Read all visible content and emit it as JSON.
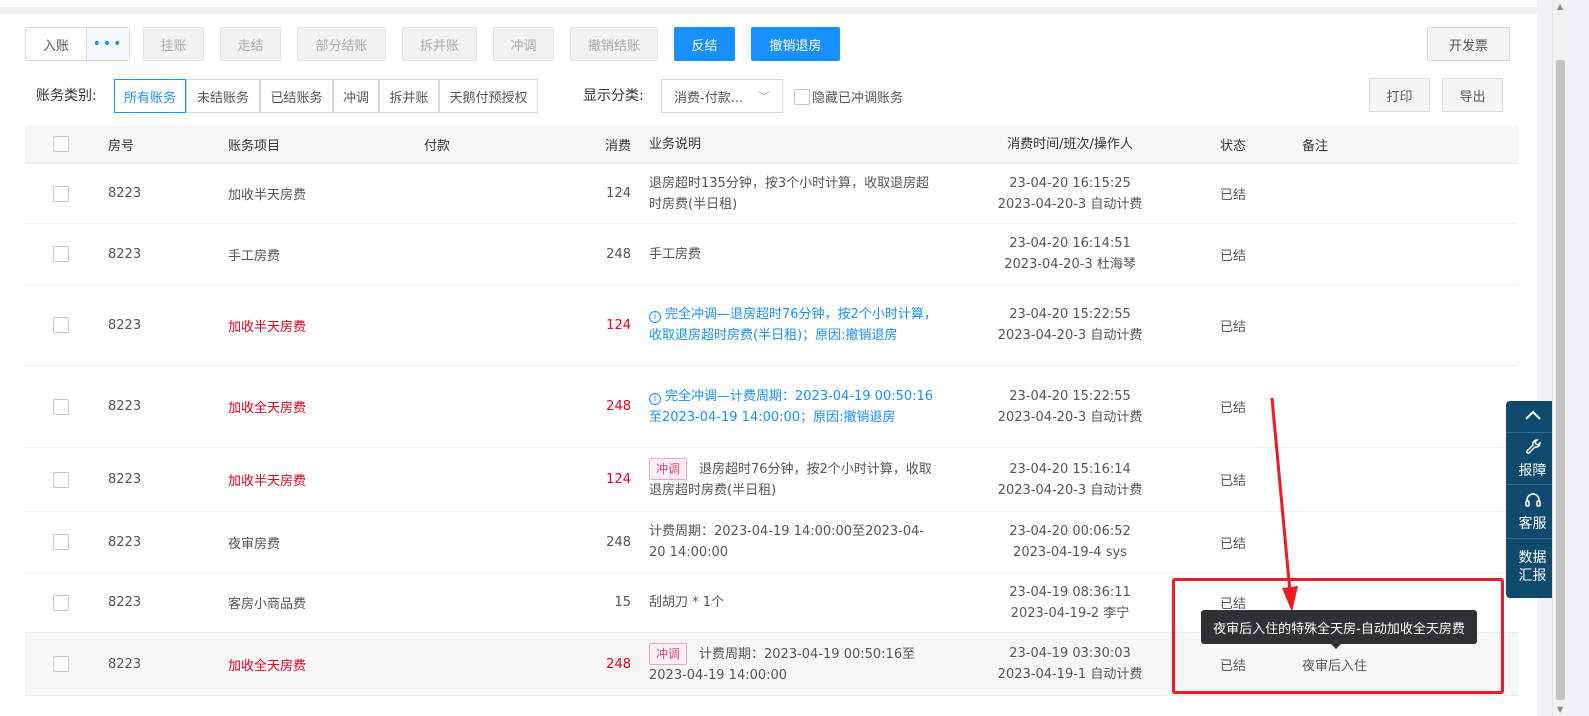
{
  "toolbar": {
    "post_label": "入账",
    "more_label": "•••",
    "disabled_buttons": [
      "挂账",
      "走结",
      "部分结账",
      "拆并账",
      "冲调",
      "撤销结账"
    ],
    "reverse_checkout_label": "反结",
    "cancel_checkout_label": "撤销退房",
    "invoice_label": "开发票",
    "print_label": "打印",
    "export_label": "导出"
  },
  "filters": {
    "category_label": "账务类别:",
    "categories": [
      "所有账务",
      "未结账务",
      "已结账务",
      "冲调",
      "拆并账",
      "天鹅付预授权"
    ],
    "active_category": "所有账务",
    "display_label": "显示分类:",
    "display_value": "消费-付款...",
    "hide_reversed_label": "隐藏已冲调账务"
  },
  "table": {
    "headers": {
      "room": "房号",
      "item": "账务项目",
      "payment": "付款",
      "amount": "消费",
      "description": "业务说明",
      "time": "消费时间/班次/操作人",
      "status": "状态",
      "note": "备注"
    },
    "rows": [
      {
        "room": "8223",
        "item": "加收半天房费",
        "amount": "124",
        "red": false,
        "tag": "",
        "info": false,
        "description": "退房超时135分钟，按3个小时计算，收取退房超时房费(半日租)",
        "time1": "23-04-20 16:15:25",
        "time2": "2023-04-20-3 自动计费",
        "status": "已结",
        "note": ""
      },
      {
        "room": "8223",
        "item": "手工房费",
        "amount": "248",
        "red": false,
        "tag": "",
        "info": false,
        "description": "手工房费",
        "time1": "23-04-20 16:14:51",
        "time2": "2023-04-20-3 杜海琴",
        "status": "已结",
        "note": ""
      },
      {
        "room": "8223",
        "item": "加收半天房费",
        "amount": "124",
        "red": true,
        "tag": "",
        "info": true,
        "description": "完全冲调—退房超时76分钟，按2个小时计算，收取退房超时房费(半日租)；原因:撤销退房",
        "time1": "23-04-20 15:22:55",
        "time2": "2023-04-20-3 自动计费",
        "status": "已结",
        "note": ""
      },
      {
        "room": "8223",
        "item": "加收全天房费",
        "amount": "248",
        "red": true,
        "tag": "",
        "info": true,
        "description": "完全冲调—计费周期：2023-04-19 00:50:16至2023-04-19 14:00:00；原因:撤销退房",
        "time1": "23-04-20 15:22:55",
        "time2": "2023-04-20-3 自动计费",
        "status": "已结",
        "note": ""
      },
      {
        "room": "8223",
        "item": "加收半天房费",
        "amount": "124",
        "red": true,
        "tag": "冲调",
        "info": false,
        "description": "退房超时76分钟，按2个小时计算，收取退房超时房费(半日租)",
        "time1": "23-04-20 15:16:14",
        "time2": "2023-04-20-3 自动计费",
        "status": "已结",
        "note": ""
      },
      {
        "room": "8223",
        "item": "夜审房费",
        "amount": "248",
        "red": false,
        "tag": "",
        "info": false,
        "description": "计费周期：2023-04-19 14:00:00至2023-04-20 14:00:00",
        "time1": "23-04-20 00:06:52",
        "time2": "2023-04-19-4 sys",
        "status": "已结",
        "note": ""
      },
      {
        "room": "8223",
        "item": "客房小商品费",
        "amount": "15",
        "red": false,
        "tag": "",
        "info": false,
        "description": "刮胡刀 * 1个",
        "time1": "23-04-19 08:36:11",
        "time2": "2023-04-19-2 李宁",
        "status": "已结",
        "note": ""
      },
      {
        "room": "8223",
        "item": "加收全天房费",
        "amount": "248",
        "red": true,
        "tag": "冲调",
        "info": false,
        "description": "计费周期：2023-04-19 00:50:16至2023-04-19 14:00:00",
        "time1": "23-04-19 03:30:03",
        "time2": "2023-04-19-1 自动计费",
        "status": "已结",
        "note": "夜审后入住"
      }
    ]
  },
  "tooltip": {
    "text": "夜审后入住的特殊全天房-自动加收全天房费"
  },
  "float_bar": {
    "items": [
      {
        "icon": "chevron-up-icon",
        "label": ""
      },
      {
        "icon": "wrench-icon",
        "label": "报障"
      },
      {
        "icon": "headset-icon",
        "label": "客服"
      },
      {
        "icon": "",
        "label": "数据汇报"
      }
    ]
  },
  "annotation": {
    "box_color": "#ee1b24",
    "arrow_color": "#ee1b24"
  },
  "colors": {
    "primary": "#1890ff",
    "reverse": "#e8001c",
    "tag": "#e6457a"
  }
}
